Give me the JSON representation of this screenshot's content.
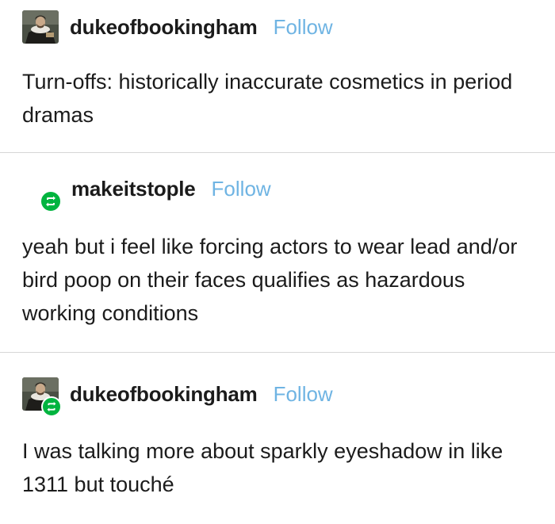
{
  "colors": {
    "follow_link": "#6fb4e3",
    "reblog_badge": "#00b43f",
    "text": "#1b1b1b",
    "divider": "#d6d6d6"
  },
  "posts": [
    {
      "username": "dukeofbookingham",
      "follow_label": "Follow",
      "avatar_icon": "portrait-avatar-icon",
      "text": "Turn-offs: historically inaccurate cosmetics in period dramas"
    },
    {
      "username": "makeitstople",
      "follow_label": "Follow",
      "avatar_icon": "reblog-icon",
      "text": "yeah but i feel like forcing actors to wear lead and/or bird poop on their faces qualifies as hazardous working conditions"
    },
    {
      "username": "dukeofbookingham",
      "follow_label": "Follow",
      "avatar_icon": "portrait-avatar-icon",
      "text": "I was talking more about sparkly eyeshadow in like 1311 but touché"
    }
  ]
}
